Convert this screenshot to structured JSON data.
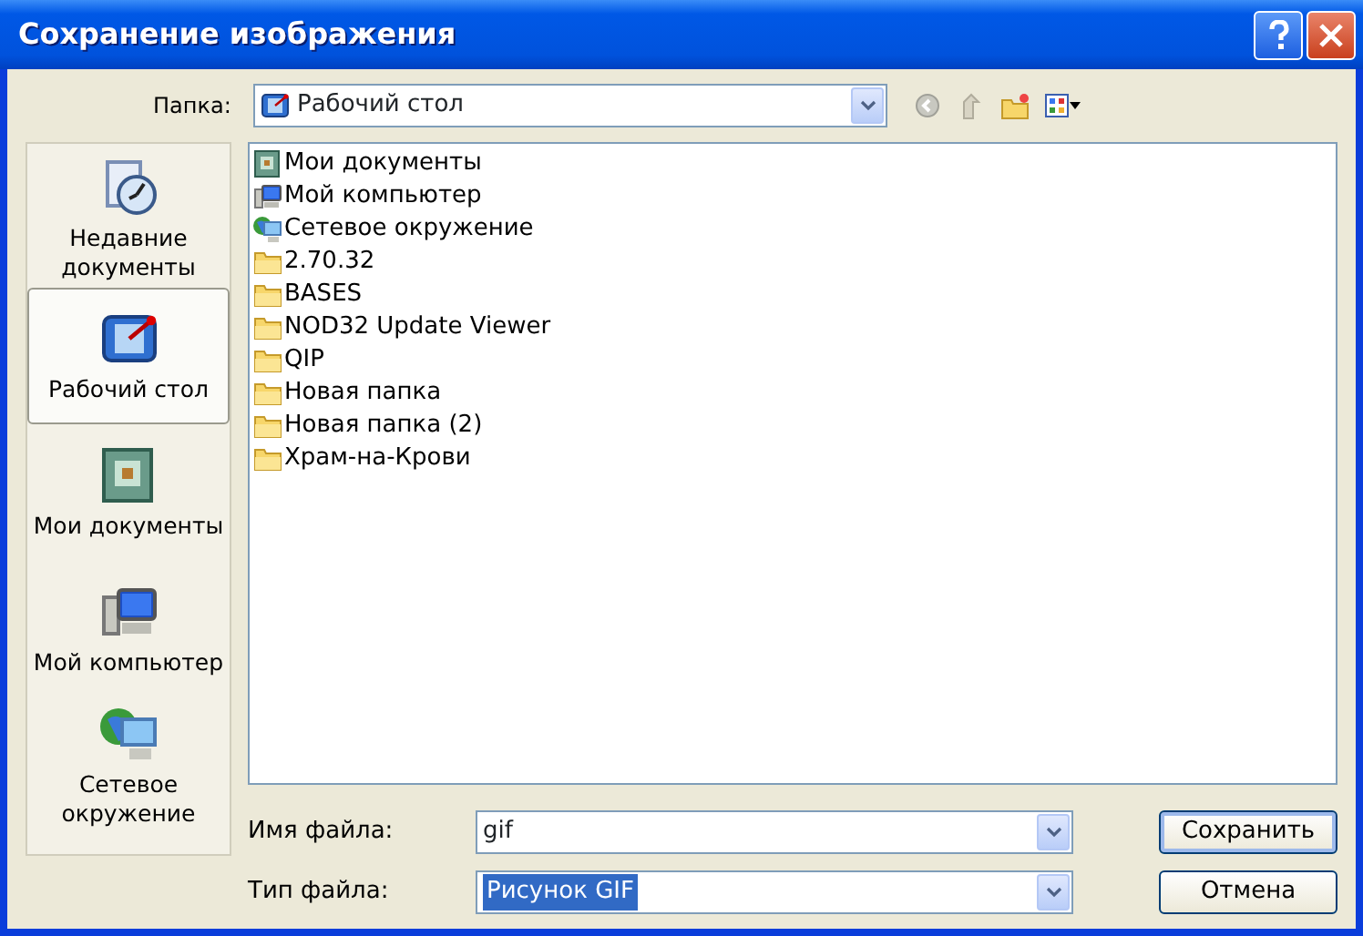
{
  "window": {
    "title": "Сохранение изображения"
  },
  "folder": {
    "label": "Папка:",
    "value": "Рабочий стол"
  },
  "places": [
    {
      "kind": "recent",
      "label": "Недавние документы",
      "selected": false
    },
    {
      "kind": "desktop",
      "label": "Рабочий стол",
      "selected": true
    },
    {
      "kind": "documents",
      "label": "Мои документы",
      "selected": false
    },
    {
      "kind": "computer",
      "label": "Мой компьютер",
      "selected": false
    },
    {
      "kind": "network",
      "label": "Сетевое окружение",
      "selected": false
    }
  ],
  "files": [
    {
      "kind": "documents",
      "name": "Мои документы"
    },
    {
      "kind": "computer",
      "name": "Мой компьютер"
    },
    {
      "kind": "network",
      "name": "Сетевое окружение"
    },
    {
      "kind": "folder",
      "name": "2.70.32"
    },
    {
      "kind": "folder",
      "name": "BASES"
    },
    {
      "kind": "folder",
      "name": "NOD32 Update Viewer"
    },
    {
      "kind": "folder",
      "name": "QIP"
    },
    {
      "kind": "folder",
      "name": "Новая папка"
    },
    {
      "kind": "folder",
      "name": "Новая папка (2)"
    },
    {
      "kind": "folder",
      "name": "Храм-на-Крови"
    }
  ],
  "filename": {
    "label": "Имя файла:",
    "value": "gif"
  },
  "filetype": {
    "label": "Тип файла:",
    "value": "Рисунок GIF"
  },
  "buttons": [
    {
      "label": "Сохранить",
      "default": true
    },
    {
      "label": "Отмена",
      "default": false
    }
  ]
}
